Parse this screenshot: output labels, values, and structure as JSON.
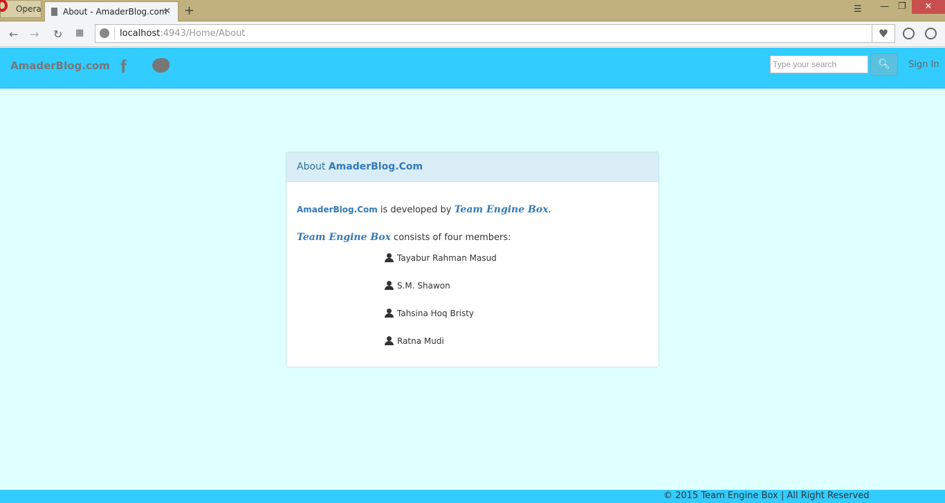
{
  "browser": {
    "opera_label": "Opera",
    "tab_title": "About - AmaderBlog.com",
    "url_host": "localhost",
    "url_path": ":4943/Home/About"
  },
  "navbar": {
    "brand": "AmaderBlog.com",
    "facebook": "f",
    "search_placeholder": "Type your search",
    "signin": "Sign In"
  },
  "panel": {
    "heading_prefix": "About ",
    "heading_brand": "AmaderBlog.Com",
    "line1_brand": "AmaderBlog.Com",
    "line1_mid": " is developed by ",
    "team": "Team Engine Box",
    "line1_end": ".",
    "line2_rest": " consists of four members:",
    "members": [
      "Tayabur Rahman Masud",
      "S.M. Shawon",
      "Tahsina Hoq Bristy",
      "Ratna Mudi"
    ]
  },
  "footer": {
    "text": "© 2015 Team Engine Box | All Right Reserved"
  }
}
